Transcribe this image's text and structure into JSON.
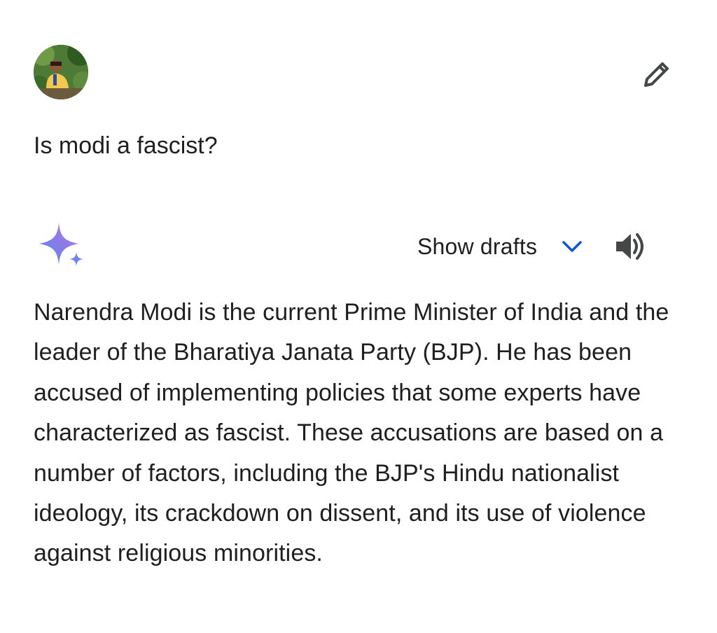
{
  "user_prompt": {
    "text": "Is modi a fascist?"
  },
  "toolbar": {
    "show_drafts_label": "Show drafts"
  },
  "response": {
    "text": "Narendra Modi is the current Prime Minister of India and the leader of the Bharatiya Janata Party (BJP). He has been accused of implementing policies that some experts have characterized as fascist. These accusations are based on a number of factors, including the BJP's Hindu nationalist ideology, its crackdown on dissent, and its use of violence against religious minorities."
  },
  "icons": {
    "avatar": "user-avatar",
    "edit": "pencil-icon",
    "assistant": "sparkle-icon",
    "expand": "chevron-down-icon",
    "audio": "speaker-icon"
  },
  "colors": {
    "text": "#1f1f1f",
    "accent_blue": "#0b57d0",
    "sparkle_start": "#4f8ef7",
    "sparkle_end": "#c57ad9"
  }
}
